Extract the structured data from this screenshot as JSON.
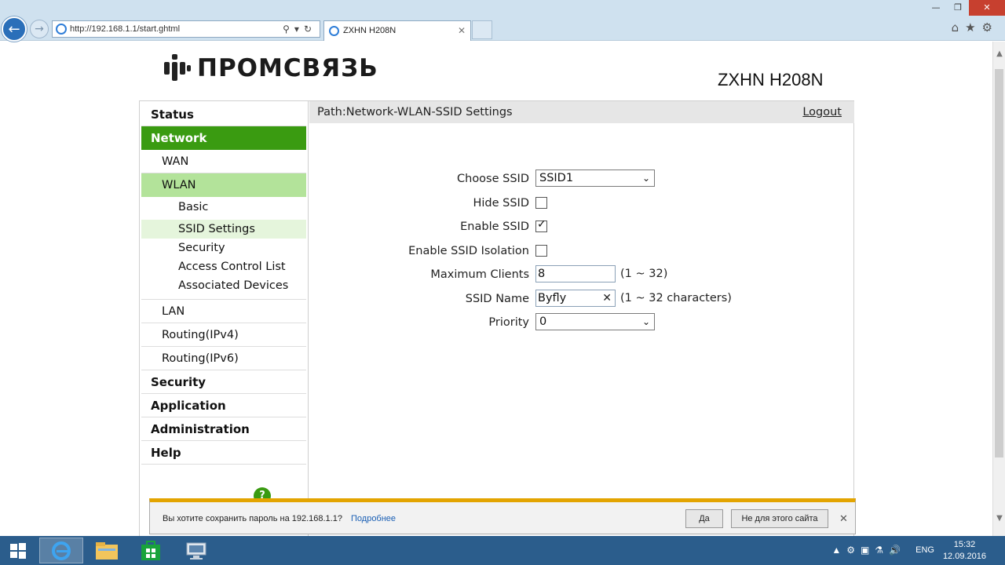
{
  "browser": {
    "url": "http://192.168.1.1/start.ghtml",
    "tab_title": "ZXHN H208N"
  },
  "header": {
    "logo_text": "ПРОМСВЯЗЬ",
    "model": "ZXHN H208N"
  },
  "sidebar": {
    "items": [
      {
        "label": "Status",
        "level": 1
      },
      {
        "label": "Network",
        "level": 1,
        "active": true
      },
      {
        "label": "WAN",
        "level": 2
      },
      {
        "label": "WLAN",
        "level": 2,
        "active": true
      },
      {
        "label": "Basic",
        "level": 3
      },
      {
        "label": "SSID Settings",
        "level": 3,
        "active": true
      },
      {
        "label": "Security",
        "level": 3
      },
      {
        "label": "Access Control List",
        "level": 3
      },
      {
        "label": "Associated Devices",
        "level": 3
      },
      {
        "label": "LAN",
        "level": 2
      },
      {
        "label": "Routing(IPv4)",
        "level": 2
      },
      {
        "label": "Routing(IPv6)",
        "level": 2
      },
      {
        "label": "Security",
        "level": 1
      },
      {
        "label": "Application",
        "level": 1
      },
      {
        "label": "Administration",
        "level": 1
      },
      {
        "label": "Help",
        "level": 1
      }
    ]
  },
  "content": {
    "path": "Path:Network-WLAN-SSID Settings",
    "logout": "Logout",
    "form": {
      "choose_ssid": {
        "label": "Choose SSID",
        "value": "SSID1"
      },
      "hide_ssid": {
        "label": "Hide SSID",
        "checked": false
      },
      "enable_ssid": {
        "label": "Enable SSID",
        "checked": true
      },
      "enable_isolation": {
        "label": "Enable SSID Isolation",
        "checked": false
      },
      "max_clients": {
        "label": "Maximum Clients",
        "value": "8",
        "hint": "(1 ~ 32)"
      },
      "ssid_name": {
        "label": "SSID Name",
        "value": "Byfly",
        "hint": "(1 ~ 32 characters)"
      },
      "priority": {
        "label": "Priority",
        "value": "0"
      }
    }
  },
  "notification": {
    "message": "Вы хотите сохранить пароль на 192.168.1.1?",
    "link": "Подробнее",
    "yes": "Да",
    "no": "Не для этого сайта"
  },
  "taskbar": {
    "lang": "ENG",
    "time": "15:32",
    "date": "12.09.2016"
  }
}
